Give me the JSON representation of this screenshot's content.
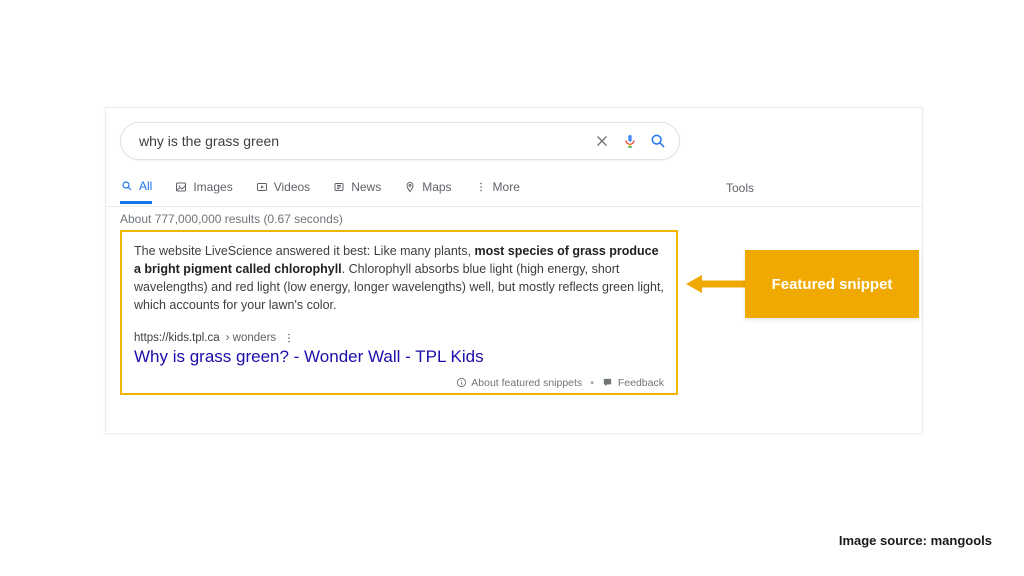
{
  "search": {
    "query": "why is the grass green",
    "placeholder": ""
  },
  "tabs": {
    "items": [
      "All",
      "Images",
      "Videos",
      "News",
      "Maps",
      "More"
    ],
    "tools_label": "Tools"
  },
  "stats": "About 777,000,000 results (0.67 seconds)",
  "snippet": {
    "text_lead": "The website LiveScience answered it best: Like many plants, ",
    "text_bold": "most species of grass produce a bright pigment called chlorophyll",
    "text_tail": ". Chlorophyll absorbs blue light (high energy, short wavelengths) and red light (low energy, longer wavelengths) well, but mostly reflects green light, which accounts for your lawn's color.",
    "url_domain": "https://kids.tpl.ca",
    "url_path": " › wonders",
    "title": "Why is grass green? - Wonder Wall - TPL Kids",
    "footer_about": "About featured snippets",
    "footer_feedback": "Feedback"
  },
  "annotation": {
    "label": "Featured snippet",
    "arrow_color": "#f0a900"
  },
  "caption": "Image source: mangools"
}
